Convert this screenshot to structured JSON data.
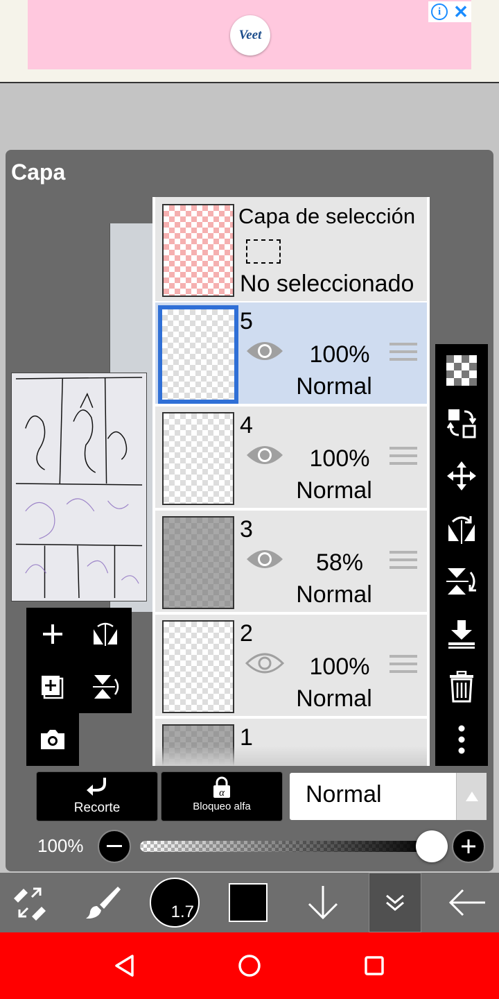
{
  "ad": {
    "brand": "Veet"
  },
  "panel": {
    "title": "Capa"
  },
  "selection_layer": {
    "title": "Capa de selección",
    "status": "No seleccionado"
  },
  "layers": [
    {
      "name": "5",
      "opacity": "100%",
      "mode": "Normal",
      "visible": true,
      "selected": true
    },
    {
      "name": "4",
      "opacity": "100%",
      "mode": "Normal",
      "visible": true,
      "selected": false
    },
    {
      "name": "3",
      "opacity": "58%",
      "mode": "Normal",
      "visible": true,
      "selected": false
    },
    {
      "name": "2",
      "opacity": "100%",
      "mode": "Normal",
      "visible": false,
      "selected": false
    },
    {
      "name": "1",
      "opacity": "",
      "mode": "",
      "visible": false,
      "selected": false
    }
  ],
  "actions": {
    "clipping": "Recorte",
    "alpha_lock": "Bloqueo alfa"
  },
  "blend_mode": {
    "value": "Normal"
  },
  "opacity": {
    "label": "100%",
    "value": 1.0
  },
  "brush": {
    "size": "1.7",
    "color": "#000000"
  },
  "colors": {
    "selected_border": "#2f6fd6",
    "navbar": "#ff0000"
  },
  "icons": {
    "right_toolbar": [
      "transparency-icon",
      "swap-layer-icon",
      "move-icon",
      "flip-horizontal-icon",
      "flip-vertical-icon",
      "merge-down-icon",
      "trash-icon",
      "more-icon"
    ],
    "bottom_bar": [
      "transform-icon",
      "brush-icon",
      "brush-size-icon",
      "color-swatch",
      "down-arrow-icon",
      "double-chevron-icon",
      "back-arrow-icon"
    ]
  }
}
